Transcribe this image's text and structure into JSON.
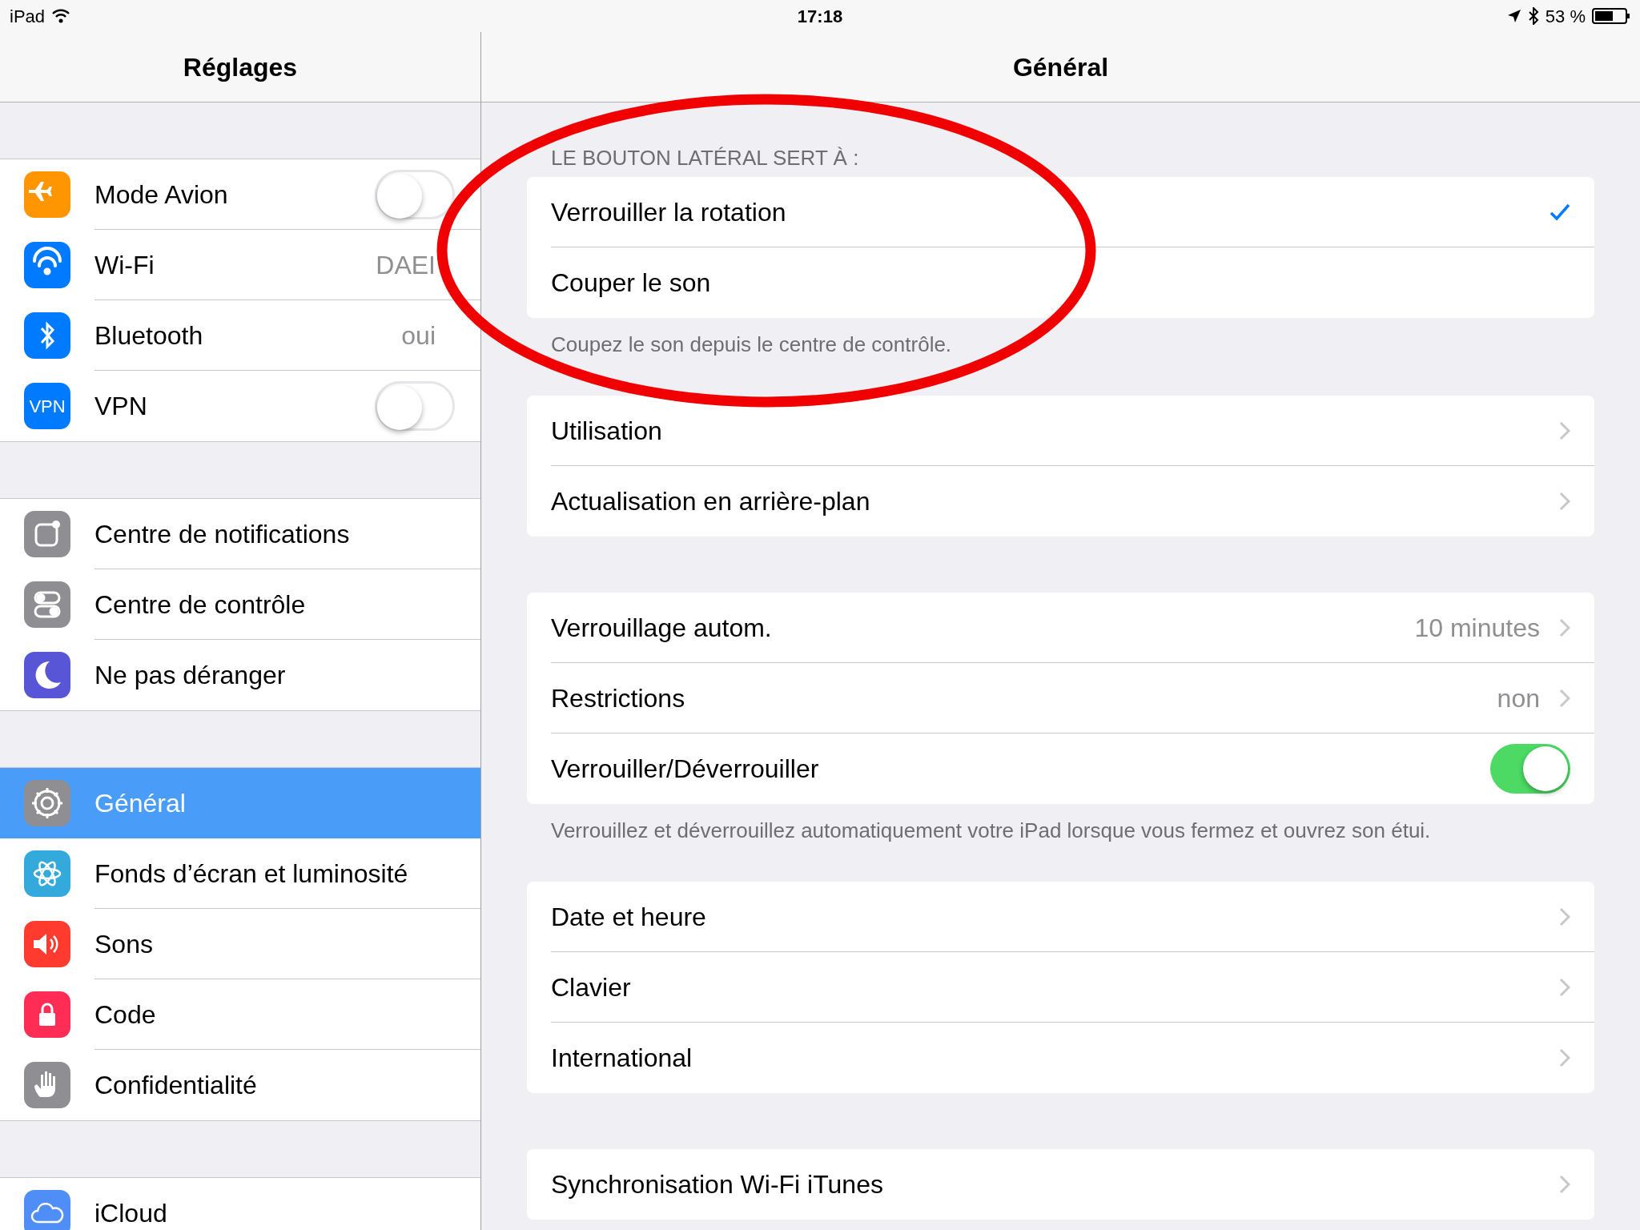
{
  "status_bar": {
    "device": "iPad",
    "time": "17:18",
    "battery": "53 %"
  },
  "sidebar": {
    "title": "Réglages",
    "groups": [
      [
        {
          "label": "Mode Avion",
          "kind": "toggle",
          "on": false,
          "selected": false
        },
        {
          "label": "Wi-Fi",
          "kind": "value",
          "value": "DAEI",
          "selected": false
        },
        {
          "label": "Bluetooth",
          "kind": "value",
          "value": "oui",
          "selected": false
        },
        {
          "label": "VPN",
          "kind": "toggle",
          "on": false,
          "icon_text": "VPN",
          "selected": false
        }
      ],
      [
        {
          "label": "Centre de notifications",
          "kind": "plain",
          "selected": false
        },
        {
          "label": "Centre de contrôle",
          "kind": "plain",
          "selected": false
        },
        {
          "label": "Ne pas déranger",
          "kind": "plain",
          "selected": false
        }
      ],
      [
        {
          "label": "Général",
          "kind": "plain",
          "selected": true
        },
        {
          "label": "Fonds d’écran et luminosité",
          "kind": "plain",
          "selected": false
        },
        {
          "label": "Sons",
          "kind": "plain",
          "selected": false
        },
        {
          "label": "Code",
          "kind": "plain",
          "selected": false
        },
        {
          "label": "Confidentialité",
          "kind": "plain",
          "selected": false
        }
      ],
      [
        {
          "label": "iCloud",
          "kind": "plain",
          "selected": false
        }
      ]
    ]
  },
  "main": {
    "title": "Général",
    "sections": [
      {
        "header": "LE BOUTON LATÉRAL SERT À :",
        "rows": [
          {
            "label": "Verrouiller la rotation",
            "kind": "check",
            "checked": true
          },
          {
            "label": "Couper le son",
            "kind": "check",
            "checked": false
          }
        ],
        "footer": "Coupez le son depuis le centre de contrôle."
      },
      {
        "rows": [
          {
            "label": "Utilisation",
            "kind": "link"
          },
          {
            "label": "Actualisation en arrière-plan",
            "kind": "link"
          }
        ]
      },
      {
        "rows": [
          {
            "label": "Verrouillage autom.",
            "kind": "link",
            "value": "10 minutes"
          },
          {
            "label": "Restrictions",
            "kind": "link",
            "value": "non"
          },
          {
            "label": "Verrouiller/Déverrouiller",
            "kind": "toggle",
            "on": true
          }
        ],
        "footer": "Verrouillez et déverrouillez automatiquement votre iPad lorsque vous fermez et ouvrez son étui."
      },
      {
        "rows": [
          {
            "label": "Date et heure",
            "kind": "link"
          },
          {
            "label": "Clavier",
            "kind": "link"
          },
          {
            "label": "International",
            "kind": "link"
          }
        ]
      },
      {
        "rows": [
          {
            "label": "Synchronisation Wi-Fi iTunes",
            "kind": "link"
          }
        ]
      }
    ]
  }
}
